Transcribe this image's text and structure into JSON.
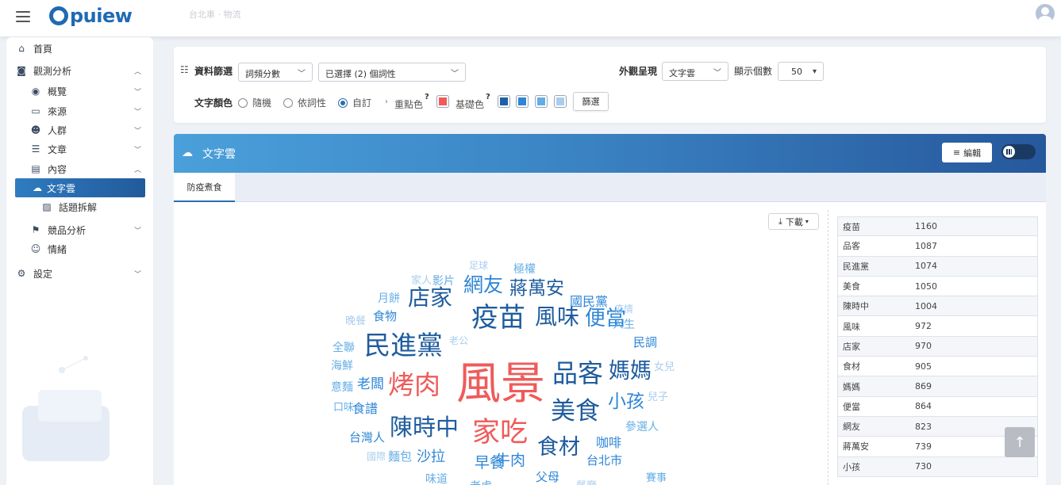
{
  "topbar": {
    "logo": "opuiew",
    "logo_rest": "puiew",
    "faded_breadcrumb": "台北車 · 物流"
  },
  "sidebar": {
    "items": [
      {
        "label": "首頁",
        "icon": "home-icon"
      },
      {
        "label": "觀測分析",
        "icon": "monitor-icon"
      },
      {
        "label": "概覽",
        "icon": "eye-icon"
      },
      {
        "label": "來源",
        "icon": "folder-icon"
      },
      {
        "label": "人群",
        "icon": "people-icon"
      },
      {
        "label": "文章",
        "icon": "document-icon"
      },
      {
        "label": "內容",
        "icon": "chart-icon"
      },
      {
        "label": "文字雲",
        "icon": "cloud-icon"
      },
      {
        "label": "話題拆解",
        "icon": "topic-icon"
      },
      {
        "label": "競品分析",
        "icon": "compete-icon"
      },
      {
        "label": "情緒",
        "icon": "smile-icon"
      },
      {
        "label": "設定",
        "icon": "gear-icon"
      }
    ]
  },
  "filter": {
    "data_filter_label": "資料篩選",
    "sort_select": "詞頻分數",
    "pos_select": "已選擇 (2) 個詞性",
    "appearance_label": "外觀呈現",
    "appearance_select": "文字雲",
    "count_label": "顯示個數",
    "count_select": "50",
    "text_color_label": "文字顏色",
    "radio_random": "隨機",
    "radio_pos": "依詞性",
    "radio_custom": "自訂",
    "highlight_label": "重點色",
    "base_label": "基礎色",
    "question": "?",
    "filter_button": "篩選",
    "colors": {
      "highlight": "#f25a5a",
      "base": [
        "#1e5fa8",
        "#2f86d6",
        "#64aee6",
        "#a9cdef"
      ]
    }
  },
  "wordcloud": {
    "title": "文字雲",
    "edit_button": "編輯",
    "tab": "防疫煮食",
    "download_button": "下載",
    "words": [
      {
        "text": "風景",
        "size": 56,
        "color": "#ef5b5b"
      },
      {
        "text": "疫苗",
        "size": 34,
        "color": "#1f5c9e"
      },
      {
        "text": "品客",
        "size": 32,
        "color": "#1f5c9e"
      },
      {
        "text": "民進黨",
        "size": 33,
        "color": "#1f5c9e"
      },
      {
        "text": "美食",
        "size": 31,
        "color": "#1f5c9e"
      },
      {
        "text": "陳時中",
        "size": 29,
        "color": "#1f5c9e"
      },
      {
        "text": "風味",
        "size": 28,
        "color": "#1f5c9e"
      },
      {
        "text": "店家",
        "size": 28,
        "color": "#1f5c9e"
      },
      {
        "text": "食材",
        "size": 27,
        "color": "#1f5c9e"
      },
      {
        "text": "媽媽",
        "size": 27,
        "color": "#1f5c9e"
      },
      {
        "text": "便當",
        "size": 26,
        "color": "#2f86d6"
      },
      {
        "text": "網友",
        "size": 25,
        "color": "#2f86d6"
      },
      {
        "text": "蔣萬安",
        "size": 23,
        "color": "#1f5c9e"
      },
      {
        "text": "小孩",
        "size": 23,
        "color": "#2f86d6"
      },
      {
        "text": "烤肉",
        "size": 33,
        "color": "#ef5b5b"
      },
      {
        "text": "家吃",
        "size": 35,
        "color": "#ef5b5b"
      },
      {
        "text": "國民黨",
        "size": 16,
        "color": "#2f86d6"
      },
      {
        "text": "人生",
        "size": 14,
        "color": "#64aee6"
      },
      {
        "text": "民調",
        "size": 15,
        "color": "#2f86d6"
      },
      {
        "text": "女兒",
        "size": 13,
        "color": "#a9cdef"
      },
      {
        "text": "兒子",
        "size": 13,
        "color": "#a9cdef"
      },
      {
        "text": "參選人",
        "size": 14,
        "color": "#64aee6"
      },
      {
        "text": "咖啡",
        "size": 16,
        "color": "#2f86d6"
      },
      {
        "text": "台北市",
        "size": 15,
        "color": "#2f86d6"
      },
      {
        "text": "賽事",
        "size": 13,
        "color": "#64aee6"
      },
      {
        "text": "父母",
        "size": 15,
        "color": "#2f86d6"
      },
      {
        "text": "餐廳",
        "size": 13,
        "color": "#a9cdef"
      },
      {
        "text": "老虎",
        "size": 14,
        "color": "#64aee6"
      },
      {
        "text": "牛肉",
        "size": 19,
        "color": "#2f86d6"
      },
      {
        "text": "早餐",
        "size": 19,
        "color": "#2f86d6"
      },
      {
        "text": "沙拉",
        "size": 18,
        "color": "#2f86d6"
      },
      {
        "text": "味道",
        "size": 14,
        "color": "#64aee6"
      },
      {
        "text": "麵包",
        "size": 15,
        "color": "#64aee6"
      },
      {
        "text": "國際",
        "size": 12,
        "color": "#a9cdef"
      },
      {
        "text": "台灣人",
        "size": 15,
        "color": "#2f86d6"
      },
      {
        "text": "食譜",
        "size": 16,
        "color": "#2f86d6"
      },
      {
        "text": "口味",
        "size": 13,
        "color": "#64aee6"
      },
      {
        "text": "意麵",
        "size": 14,
        "color": "#64aee6"
      },
      {
        "text": "老闆",
        "size": 17,
        "color": "#2f86d6"
      },
      {
        "text": "海鮮",
        "size": 14,
        "color": "#64aee6"
      },
      {
        "text": "全聯",
        "size": 14,
        "color": "#64aee6"
      },
      {
        "text": "老公",
        "size": 12,
        "color": "#a9cdef"
      },
      {
        "text": "晚餐",
        "size": 13,
        "color": "#a9cdef"
      },
      {
        "text": "食物",
        "size": 15,
        "color": "#2f86d6"
      },
      {
        "text": "月餅",
        "size": 14,
        "color": "#64aee6"
      },
      {
        "text": "家人",
        "size": 13,
        "color": "#a9cdef"
      },
      {
        "text": "影片",
        "size": 14,
        "color": "#64aee6"
      },
      {
        "text": "足球",
        "size": 12,
        "color": "#a9cdef"
      },
      {
        "text": "極權",
        "size": 14,
        "color": "#64aee6"
      },
      {
        "text": "疫情",
        "size": 12,
        "color": "#a9cdef"
      }
    ]
  },
  "table": {
    "rows": [
      {
        "word": "疫苗",
        "count": "1160"
      },
      {
        "word": "品客",
        "count": "1087"
      },
      {
        "word": "民進黨",
        "count": "1074"
      },
      {
        "word": "美食",
        "count": "1050"
      },
      {
        "word": "陳時中",
        "count": "1004"
      },
      {
        "word": "風味",
        "count": "972"
      },
      {
        "word": "店家",
        "count": "970"
      },
      {
        "word": "食材",
        "count": "905"
      },
      {
        "word": "媽媽",
        "count": "869"
      },
      {
        "word": "便當",
        "count": "864"
      },
      {
        "word": "網友",
        "count": "823"
      },
      {
        "word": "蔣萬安",
        "count": "739"
      },
      {
        "word": "小孩",
        "count": "730"
      }
    ]
  },
  "scroll_top": "↑"
}
